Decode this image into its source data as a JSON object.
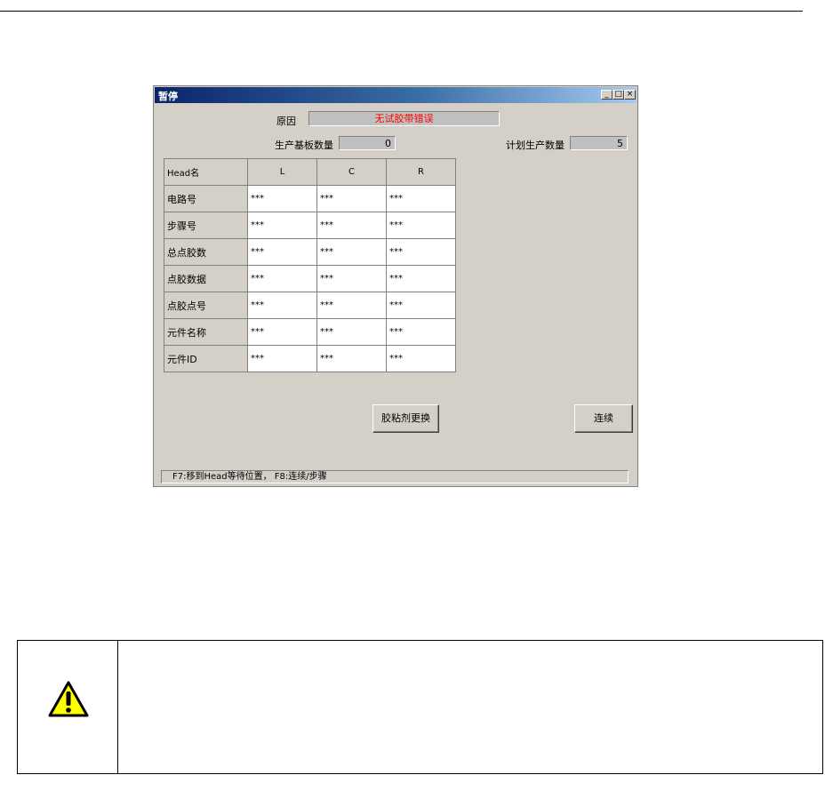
{
  "window": {
    "title": "暂停",
    "buttons": {
      "minimize": "_",
      "maximize": "□",
      "close": "×"
    }
  },
  "reason": {
    "label": "原因",
    "value": "无试胶带错误"
  },
  "production_count": {
    "label": "生产基板数量",
    "value": "0"
  },
  "planned_count": {
    "label": "计划生产数量",
    "value": "5"
  },
  "table": {
    "header": [
      "Head名",
      "L",
      "C",
      "R"
    ],
    "rows": [
      {
        "label": "电路号",
        "values": [
          "***",
          "***",
          "***"
        ]
      },
      {
        "label": "步骤号",
        "values": [
          "***",
          "***",
          "***"
        ]
      },
      {
        "label": "总点胶数",
        "values": [
          "***",
          "***",
          "***"
        ]
      },
      {
        "label": "点胶数据",
        "values": [
          "***",
          "***",
          "***"
        ]
      },
      {
        "label": "点胶点号",
        "values": [
          "***",
          "***",
          "***"
        ]
      },
      {
        "label": "元件名称",
        "values": [
          "***",
          "***",
          "***"
        ]
      },
      {
        "label": "元件ID",
        "values": [
          "***",
          "***",
          "***"
        ]
      }
    ]
  },
  "buttons": {
    "glue_replace": "胶粘剂更换",
    "continue": "连续"
  },
  "status": "F7:移到Head等待位置，  F8:连续/步骤",
  "icons": {
    "warning": "warning-icon"
  },
  "colors": {
    "error_text": "#ff0000",
    "warning_fill": "#ffff00"
  }
}
